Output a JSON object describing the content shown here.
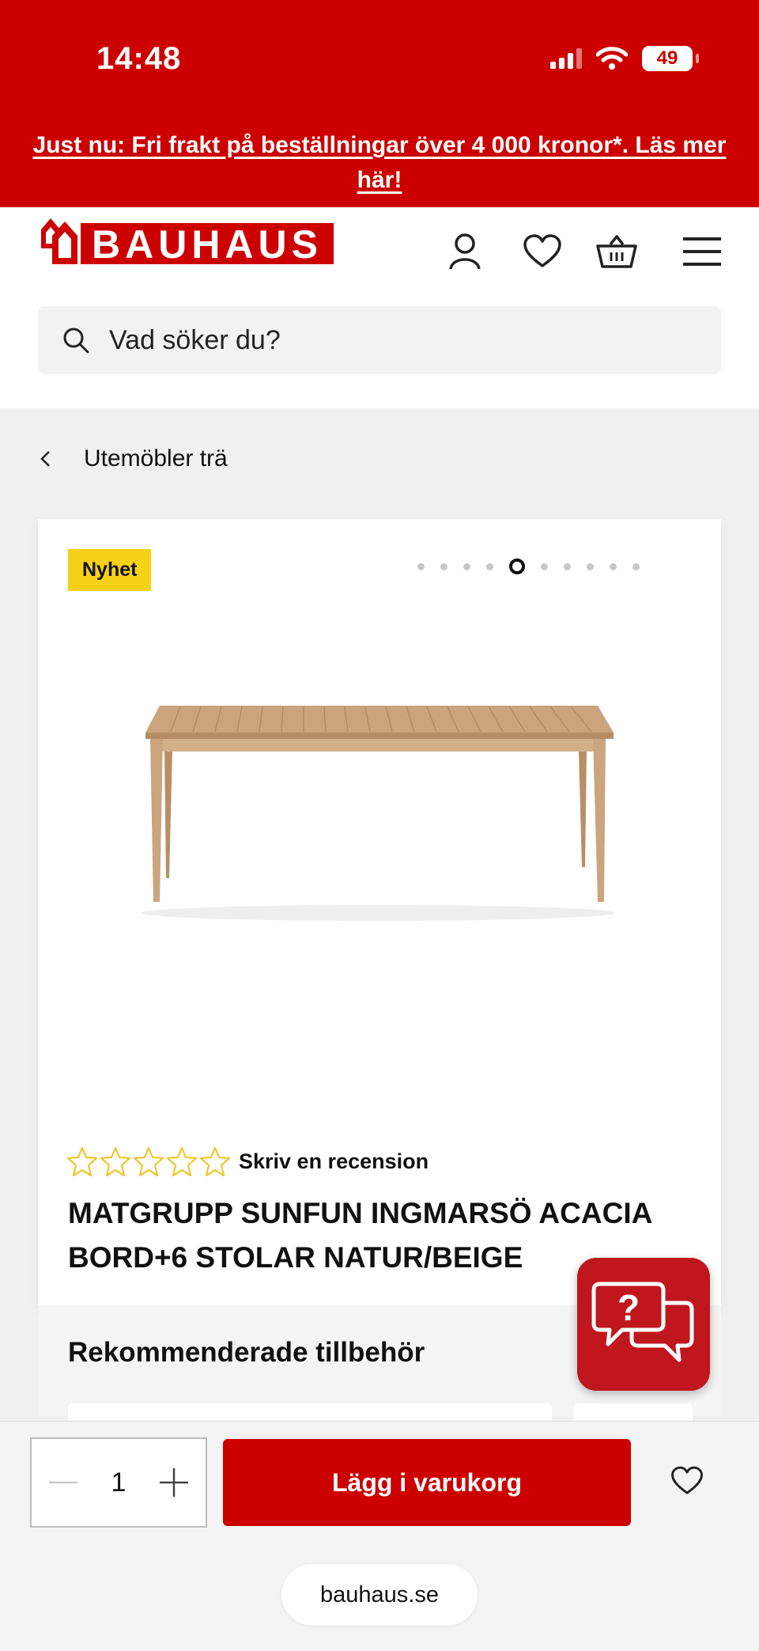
{
  "status_bar": {
    "time": "14:48",
    "battery": "49"
  },
  "promo": {
    "text": "Just nu: Fri frakt på beställningar över 4 000 kronor*. Läs mer här!"
  },
  "brand": {
    "logo_text": "BAUHAUS",
    "accent": "#cc0000"
  },
  "header": {
    "icons": [
      "user-icon",
      "heart-icon",
      "basket-icon",
      "menu-icon"
    ]
  },
  "search": {
    "placeholder": "Vad söker du?"
  },
  "breadcrumb": {
    "label": "Utemöbler trä"
  },
  "product": {
    "badge": "Nyhet",
    "gallery": {
      "total_images": 10,
      "active_index": 5
    },
    "rating": {
      "stars": 0,
      "max": 5,
      "review_link": "Skriv en recension"
    },
    "title": "MATGRUPP SUNFUN INGMARSÖ ACACIA BORD+6 STOLAR NATUR/BEIGE"
  },
  "recommended": {
    "title": "Rekommenderade tillbehör"
  },
  "purchase": {
    "quantity": "1",
    "add_to_cart": "Lägg i varukorg"
  },
  "browser": {
    "url": "bauhaus.se"
  }
}
